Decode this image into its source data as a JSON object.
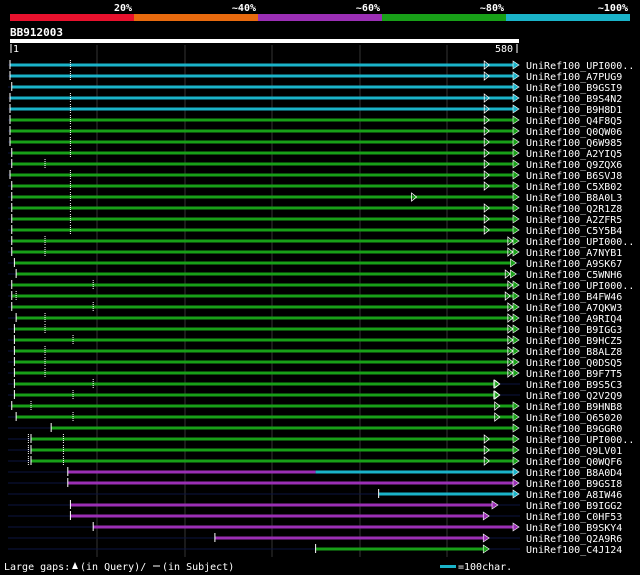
{
  "legend": {
    "percent_labels": [
      "20%",
      "~40%",
      "~60%",
      "~80%",
      "~100%"
    ],
    "colors": [
      "#e8112d",
      "#e86a0e",
      "#9b2fb5",
      "#18a018",
      "#1ab3c9"
    ]
  },
  "query": {
    "id": "BB912003",
    "start_label": "1",
    "end_label": "580"
  },
  "footer": {
    "large_gaps_label": "Large gaps:",
    "query_gap_text": "(in Query)/",
    "subject_gap_text": "(in Subject)",
    "scale_text": "=100char."
  },
  "hits": [
    {
      "name": "UniRef100_UPI000..",
      "color": "#1ab3c9",
      "start": 1,
      "end": 580,
      "gaps": [
        70
      ],
      "mark": 546
    },
    {
      "name": "UniRef100_A7PUG9",
      "color": "#1ab3c9",
      "start": 1,
      "end": 580,
      "gaps": [
        70
      ],
      "mark": 546
    },
    {
      "name": "UniRef100_B9GSI9",
      "color": "#1ab3c9",
      "start": 3,
      "end": 580,
      "gaps": [],
      "mark": null
    },
    {
      "name": "UniRef100_B9S4N2",
      "color": "#1ab3c9",
      "start": 1,
      "end": 580,
      "gaps": [
        70
      ],
      "mark": 546
    },
    {
      "name": "UniRef100_B9H8D1",
      "color": "#1ab3c9",
      "start": 1,
      "end": 580,
      "gaps": [
        70
      ],
      "mark": 546
    },
    {
      "name": "UniRef100_Q4F8Q5",
      "color": "#18a018",
      "start": 1,
      "end": 580,
      "gaps": [
        70
      ],
      "mark": 546
    },
    {
      "name": "UniRef100_Q0QW06",
      "color": "#18a018",
      "start": 1,
      "end": 580,
      "gaps": [
        70
      ],
      "mark": 546
    },
    {
      "name": "UniRef100_Q6W985",
      "color": "#18a018",
      "start": 1,
      "end": 580,
      "gaps": [
        70
      ],
      "mark": 546
    },
    {
      "name": "UniRef100_A2YIQ5",
      "color": "#18a018",
      "start": 3,
      "end": 580,
      "gaps": [
        70
      ],
      "mark": 546
    },
    {
      "name": "UniRef100_Q9ZQX6",
      "color": "#18a018",
      "start": 3,
      "end": 580,
      "gaps": [
        41
      ],
      "mark": 546
    },
    {
      "name": "UniRef100_B6SVJ8",
      "color": "#18a018",
      "start": 1,
      "end": 580,
      "gaps": [
        70
      ],
      "mark": 546
    },
    {
      "name": "UniRef100_C5XB02",
      "color": "#18a018",
      "start": 3,
      "end": 580,
      "gaps": [
        70
      ],
      "mark": 546
    },
    {
      "name": "UniRef100_B8A0L3",
      "color": "#18a018",
      "start": 3,
      "end": 580,
      "gaps": [
        70
      ],
      "mark": 463
    },
    {
      "name": "UniRef100_Q2R1Z8",
      "color": "#18a018",
      "start": 3,
      "end": 580,
      "gaps": [
        70
      ],
      "mark": 546
    },
    {
      "name": "UniRef100_A2ZFR5",
      "color": "#18a018",
      "start": 3,
      "end": 580,
      "gaps": [
        70
      ],
      "mark": 546
    },
    {
      "name": "UniRef100_C5Y5B4",
      "color": "#18a018",
      "start": 3,
      "end": 580,
      "gaps": [
        70
      ],
      "mark": 546
    },
    {
      "name": "UniRef100_UPI000..",
      "color": "#18a018",
      "start": 3,
      "end": 580,
      "gaps": [
        41
      ],
      "mark": 573
    },
    {
      "name": "UniRef100_A7NYB1",
      "color": "#18a018",
      "start": 3,
      "end": 580,
      "gaps": [
        41
      ],
      "mark": 573
    },
    {
      "name": "UniRef100_A9SK67",
      "color": "#18a018",
      "start": 6,
      "end": 577,
      "gaps": [],
      "mark": null
    },
    {
      "name": "UniRef100_C5WNH6",
      "color": "#18a018",
      "start": 8,
      "end": 577,
      "gaps": [],
      "mark": 570
    },
    {
      "name": "UniRef100_UPI000..",
      "color": "#18a018",
      "start": 3,
      "end": 580,
      "gaps": [
        96
      ],
      "mark": 573
    },
    {
      "name": "UniRef100_B4FW46",
      "color": "#18a018",
      "start": 3,
      "end": 580,
      "gaps": [
        8
      ],
      "mark": 570
    },
    {
      "name": "UniRef100_A7QKW3",
      "color": "#18a018",
      "start": 3,
      "end": 580,
      "gaps": [
        96
      ],
      "mark": 573
    },
    {
      "name": "UniRef100_A9RIQ4",
      "color": "#18a018",
      "start": 8,
      "end": 580,
      "gaps": [
        41
      ],
      "mark": 573
    },
    {
      "name": "UniRef100_B9IGG3",
      "color": "#18a018",
      "start": 6,
      "end": 580,
      "gaps": [
        41
      ],
      "mark": 573
    },
    {
      "name": "UniRef100_B9HCZ5",
      "color": "#18a018",
      "start": 6,
      "end": 580,
      "gaps": [
        73
      ],
      "mark": 573
    },
    {
      "name": "UniRef100_B8ALZ8",
      "color": "#18a018",
      "start": 6,
      "end": 580,
      "gaps": [
        41
      ],
      "mark": 573
    },
    {
      "name": "UniRef100_Q0DSQ5",
      "color": "#18a018",
      "start": 6,
      "end": 580,
      "gaps": [
        41
      ],
      "mark": 573
    },
    {
      "name": "UniRef100_B9F7T5",
      "color": "#18a018",
      "start": 6,
      "end": 580,
      "gaps": [
        41
      ],
      "mark": 573
    },
    {
      "name": "UniRef100_B9S5C3",
      "color": "#18a018",
      "start": 6,
      "end": 558,
      "gaps": [
        96
      ],
      "mark": 558
    },
    {
      "name": "UniRef100_Q2V2Q9",
      "color": "#18a018",
      "start": 6,
      "end": 558,
      "gaps": [
        73
      ],
      "mark": 558
    },
    {
      "name": "UniRef100_B9HNB8",
      "color": "#18a018",
      "start": 3,
      "end": 580,
      "gaps": [
        25
      ],
      "mark": 558
    },
    {
      "name": "UniRef100_Q65020",
      "color": "#18a018",
      "start": 8,
      "end": 580,
      "gaps": [
        73
      ],
      "mark": 558
    },
    {
      "name": "UniRef100_B9GGR0",
      "color": "#18a018",
      "start": 48,
      "end": 580,
      "gaps": [],
      "mark": null
    },
    {
      "name": "UniRef100_UPI000..",
      "color": "#18a018",
      "start": 25,
      "end": 580,
      "gaps": [
        22,
        62
      ],
      "mark": 546
    },
    {
      "name": "UniRef100_Q9LV01",
      "color": "#18a018",
      "start": 25,
      "end": 580,
      "gaps": [
        22,
        62
      ],
      "mark": 546
    },
    {
      "name": "UniRef100_Q0WQF6",
      "color": "#18a018",
      "start": 25,
      "end": 580,
      "gaps": [
        22,
        62
      ],
      "mark": 546
    },
    {
      "name": "UniRef100_B8A0D4",
      "color": "#9b2fb5",
      "start": 67,
      "end": 580,
      "gaps": [],
      "mark": 350,
      "tail": "#1ab3c9"
    },
    {
      "name": "UniRef100_B9GSI8",
      "color": "#9b2fb5",
      "start": 67,
      "end": 580,
      "gaps": [],
      "mark": null
    },
    {
      "name": "UniRef100_A8IW46",
      "color": "#1ab3c9",
      "start": 422,
      "end": 580,
      "gaps": [],
      "mark": null
    },
    {
      "name": "UniRef100_B9IGG2",
      "color": "#9b2fb5",
      "start": 70,
      "end": 556,
      "gaps": [],
      "mark": null
    },
    {
      "name": "UniRef100_C0HF53",
      "color": "#9b2fb5",
      "start": 70,
      "end": 546,
      "gaps": [],
      "mark": null
    },
    {
      "name": "UniRef100_B9SKY4",
      "color": "#9b2fb5",
      "start": 96,
      "end": 580,
      "gaps": [],
      "mark": null
    },
    {
      "name": "UniRef100_Q2A9R6",
      "color": "#9b2fb5",
      "start": 235,
      "end": 546,
      "gaps": [],
      "mark": null
    },
    {
      "name": "UniRef100_C4J124",
      "color": "#18a018",
      "start": 350,
      "end": 546,
      "gaps": [],
      "mark": null
    }
  ]
}
